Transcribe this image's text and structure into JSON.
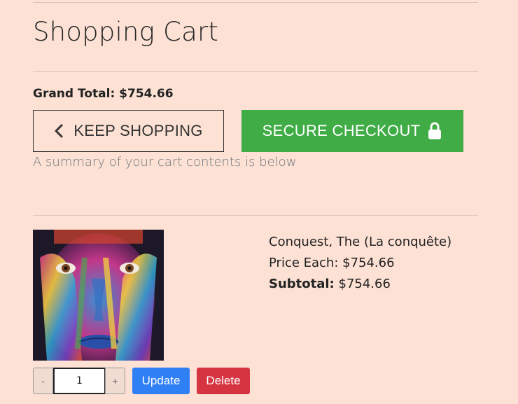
{
  "header": {
    "title": "Shopping Cart"
  },
  "cart": {
    "grand_total": "Grand Total: $754.66",
    "keep_shopping_label": "KEEP SHOPPING",
    "secure_checkout_label": "SECURE CHECKOUT",
    "summary_text": "A summary of your cart contents is below"
  },
  "items": [
    {
      "name": "Conquest, The (La conquête)",
      "price_each": "Price Each: $754.66",
      "subtotal_label": "Subtotal:",
      "subtotal_value": " $754.66",
      "quantity": "1",
      "minus_label": "-",
      "plus_label": "+",
      "update_label": "Update",
      "delete_label": "Delete"
    }
  ],
  "icons": {
    "keep_shopping": "chevron-left-icon",
    "secure_checkout": "lock-icon"
  },
  "colors": {
    "background": "#fce1d4",
    "checkout_green": "#3fac45",
    "update_blue": "#2f7ff5",
    "delete_red": "#d73442"
  }
}
